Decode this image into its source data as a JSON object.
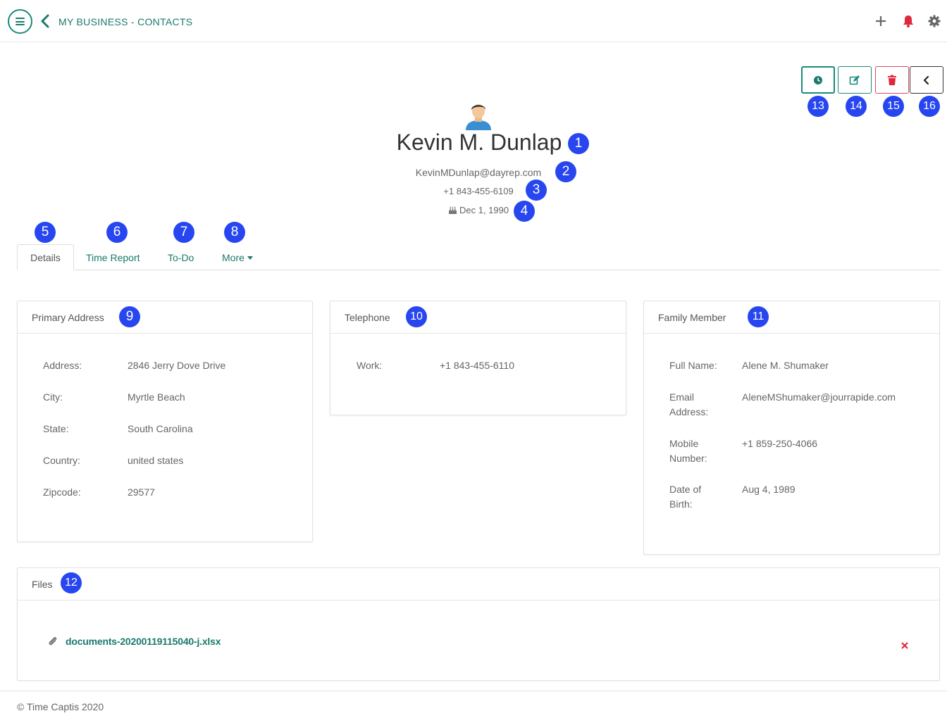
{
  "header": {
    "breadcrumb": "MY BUSINESS - CONTACTS",
    "icons": [
      "plus-icon",
      "bell-icon",
      "gear-icon"
    ]
  },
  "actions": {
    "clock_icon": "clock-icon",
    "edit_icon": "edit-icon",
    "delete_icon": "trash-icon",
    "back_icon": "chevron-left-icon"
  },
  "profile": {
    "name": "Kevin M. Dunlap",
    "email": "KevinMDunlap@dayrep.com",
    "phone": "+1 843-455-6109",
    "dob": "Dec 1, 1990"
  },
  "tabs": [
    {
      "label": "Details",
      "active": true
    },
    {
      "label": "Time Report",
      "active": false
    },
    {
      "label": "To-Do",
      "active": false
    },
    {
      "label": "More",
      "active": false
    }
  ],
  "primary_address": {
    "title": "Primary Address",
    "rows": [
      {
        "label": "Address:",
        "value": "2846 Jerry Dove Drive"
      },
      {
        "label": "City:",
        "value": "Myrtle Beach"
      },
      {
        "label": "State:",
        "value": "South Carolina"
      },
      {
        "label": "Country:",
        "value": "united states"
      },
      {
        "label": "Zipcode:",
        "value": "29577"
      }
    ]
  },
  "telephone": {
    "title": "Telephone",
    "rows": [
      {
        "label": "Work:",
        "value": "+1 843-455-6110"
      }
    ]
  },
  "family_member": {
    "title": "Family Member",
    "rows": [
      {
        "label": "Full Name:",
        "value": "Alene M. Shumaker"
      },
      {
        "label": "Email Address:",
        "value": "AleneMShumaker@jourrapide.com"
      },
      {
        "label": "Mobile Number:",
        "value": "+1 859-250-4066"
      },
      {
        "label": "Date of Birth:",
        "value": "Aug 4, 1989"
      }
    ]
  },
  "files": {
    "title": "Files",
    "items": [
      {
        "name": "documents-20200119115040-j.xlsx"
      }
    ]
  },
  "badges": [
    "1",
    "2",
    "3",
    "4",
    "5",
    "6",
    "7",
    "8",
    "9",
    "10",
    "11",
    "12",
    "13",
    "14",
    "15",
    "16"
  ],
  "footer": "© Time Captis 2020",
  "colors": {
    "accent": "#1a7a6c",
    "danger": "#e0485a",
    "badge": "#2746f0"
  }
}
